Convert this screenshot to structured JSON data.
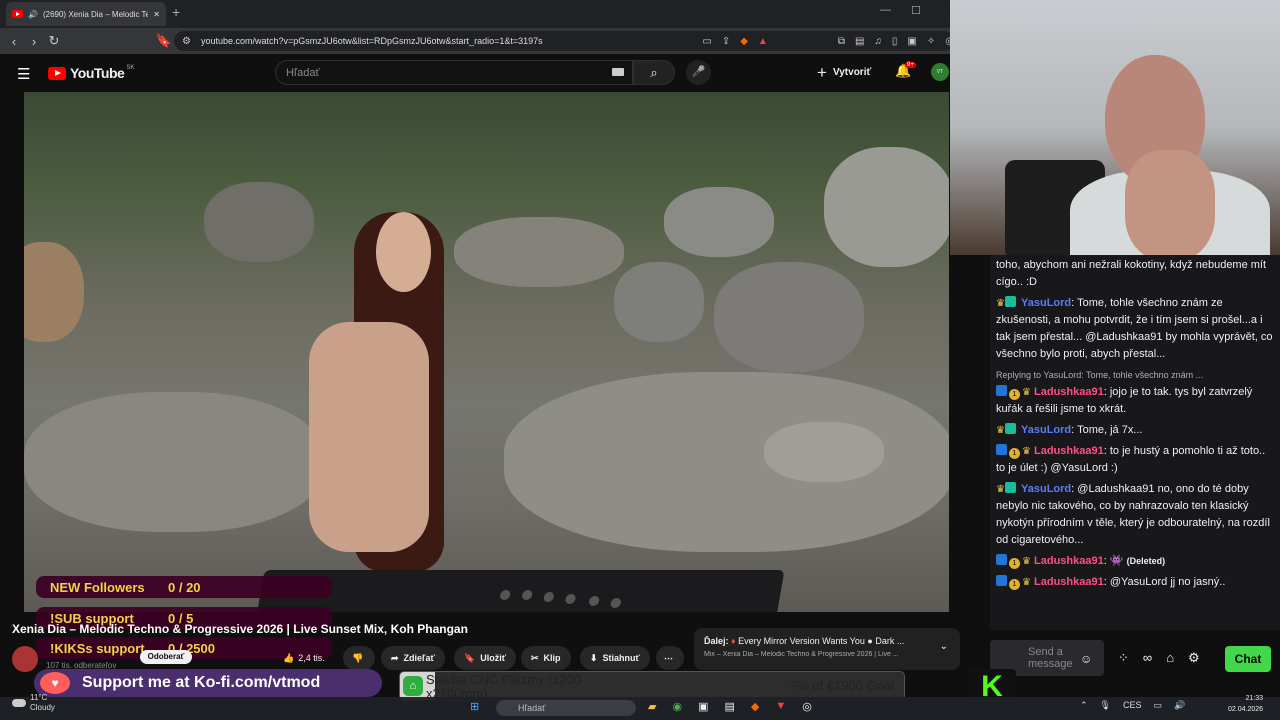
{
  "browser": {
    "tab_title": "(2690) Xenia Dia – Melodic Te",
    "url": "youtube.com/watch?v=pGsmzJU6otw&list=RDpGsmzJU6otw&start_radio=1&t=3197s"
  },
  "youtube": {
    "logo_text": "YouTube",
    "logo_region": "SK",
    "search_placeholder": "Hľadať",
    "create_label": "Vytvoriť",
    "notif_count": "9+",
    "avatar_text": "VT"
  },
  "video": {
    "title": "Xenia Dia – Melodic Techno & Progressive 2026 | Live Sunset Mix, Koh Phangan",
    "subscribers": "107 tis. odberateľov",
    "subscribe_label": "Odoberať",
    "likes": "2,4 tis.",
    "actions": {
      "share": "Zdieľať",
      "save": "Uložiť",
      "clip": "Klip",
      "download": "Stiahnuť"
    },
    "more": "⋯"
  },
  "up_next": {
    "label": "Ďalej:",
    "title": "Every Mirror Version Wants You",
    "title_tail": "Dark ...",
    "subtitle": "Mix – Xenia Dia – Melodic Techno & Progressive 2026 | Live ..."
  },
  "overlays": {
    "followers": {
      "label": "NEW Followers",
      "value": "0 / 20"
    },
    "subs": {
      "label": "!SUB support",
      "value": "0 / 5"
    },
    "kiks": {
      "label": "!KIKSs support",
      "value": "0 / 2500"
    },
    "kofi": "Support me at Ko-fi.com/vtmod",
    "cnc": {
      "label": "Stavba CNC Plazmy (1200 x2100mm)",
      "goal": "7% of €1900 Goal",
      "progress": 0.07
    }
  },
  "chat": {
    "messages": [
      {
        "user": "",
        "text": "toho, abychom ani nežrali kokotiny, když nebudeme mít cígo.. :D"
      },
      {
        "user": "YasuLord",
        "text": "Tome, tohle všechno znám ze zkušenosti, a mohu potvrdit, že i tím jsem si prošel...a i tak jsem přestal... @Ladushkaa91 by mohla vyprávět, co všechno bylo proti, abych přestal..."
      },
      {
        "reply": "Replying to YasuLord: Tome, tohle všechno znám ...",
        "user": "Ladushkaa91",
        "text": "jojo je to tak. tys byl zatvrzelý kuřák a řešili jsme to xkrát."
      },
      {
        "user": "YasuLord",
        "text": "Tome, já 7x..."
      },
      {
        "user": "Ladushkaa91",
        "text": "to je hustý a pomohlo ti až toto.. to je úlet :) @YasuLord :)"
      },
      {
        "user": "YasuLord",
        "text": "@Ladushkaa91 no, ono do té doby nebylo nic takového, co by nahrazovalo ten klasický nykotýn přírodním v těle, který je odbouratelný, na rozdíl od cigaretového..."
      },
      {
        "user": "Ladushkaa91",
        "text": "(Deleted)"
      },
      {
        "user": "Ladushkaa91",
        "text": "@YasuLord jj no jasný.."
      }
    ],
    "input_placeholder": "Send a message",
    "send_label": "Chat",
    "kick_logo": "K"
  },
  "taskbar": {
    "weather_temp": "11°C",
    "weather_desc": "Cloudy",
    "search": "Hľadať",
    "lang": "CES",
    "time": "21:33",
    "date": "02.04.2026"
  }
}
